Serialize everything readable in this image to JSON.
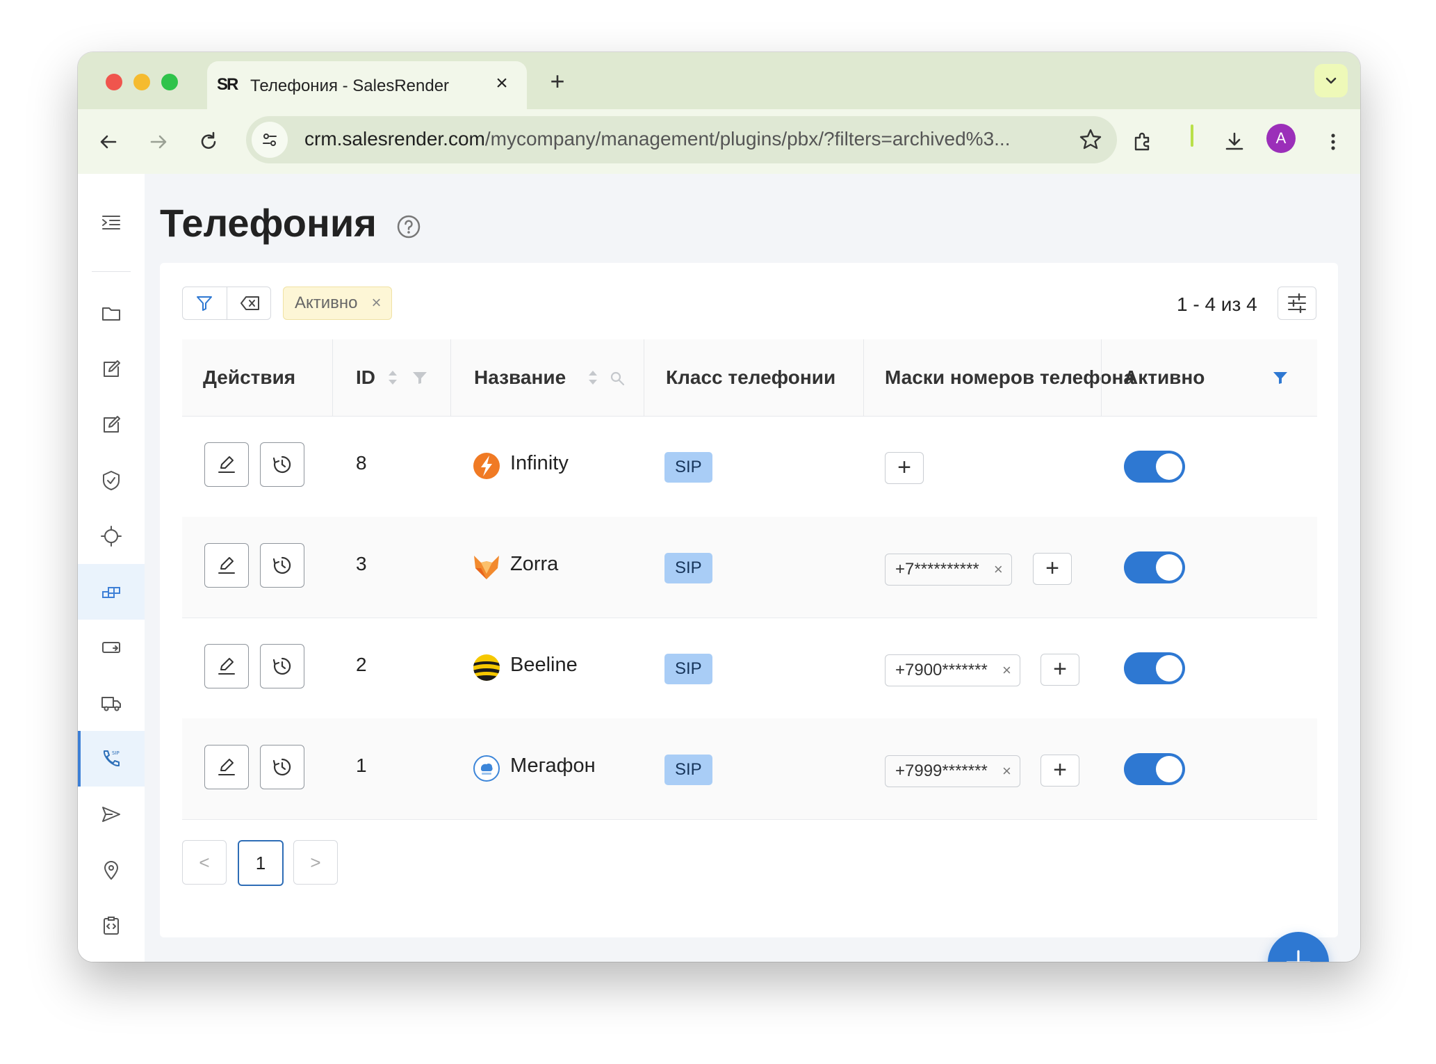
{
  "browser": {
    "tab_favicon": "SR",
    "tab_title": "Телефония - SalesRender",
    "tab_close": "×",
    "new_tab": "+",
    "url_host": "crm.salesrender.com",
    "url_path": "/mycompany/management/plugins/pbx/?filters=archived%3...",
    "avatar_letter": "A"
  },
  "page": {
    "title": "Телефония"
  },
  "filters": {
    "active_chip": "Активно",
    "chip_close": "×",
    "count": "1 - 4 из 4"
  },
  "table": {
    "headers": {
      "actions": "Действия",
      "id": "ID",
      "name": "Название",
      "class": "Класс телефонии",
      "masks": "Маски номеров телефона",
      "active": "Активно"
    },
    "rows": [
      {
        "id": "8",
        "name": "Infinity",
        "logo": "infinity-logo",
        "class": "SIP",
        "masks": [],
        "active": true
      },
      {
        "id": "3",
        "name": "Zorra",
        "logo": "zorra-fox-logo",
        "class": "SIP",
        "masks": [
          "+7**********"
        ],
        "active": true
      },
      {
        "id": "2",
        "name": "Beeline",
        "logo": "beeline-logo",
        "class": "SIP",
        "masks": [
          "+7900*******"
        ],
        "active": true
      },
      {
        "id": "1",
        "name": "Мегафон",
        "logo": "megafon-pbx-logo",
        "class": "SIP",
        "masks": [
          "+7999*******"
        ],
        "active": true
      }
    ],
    "mask_close": "×",
    "add_mask": "+"
  },
  "pagination": {
    "prev": "<",
    "current": "1",
    "next": ">"
  },
  "colors": {
    "accent": "#2e78d2",
    "sip_badge": "#a9cdf6",
    "chip_bg": "#fdf6d6",
    "tabbar": "#dfe9d1"
  }
}
